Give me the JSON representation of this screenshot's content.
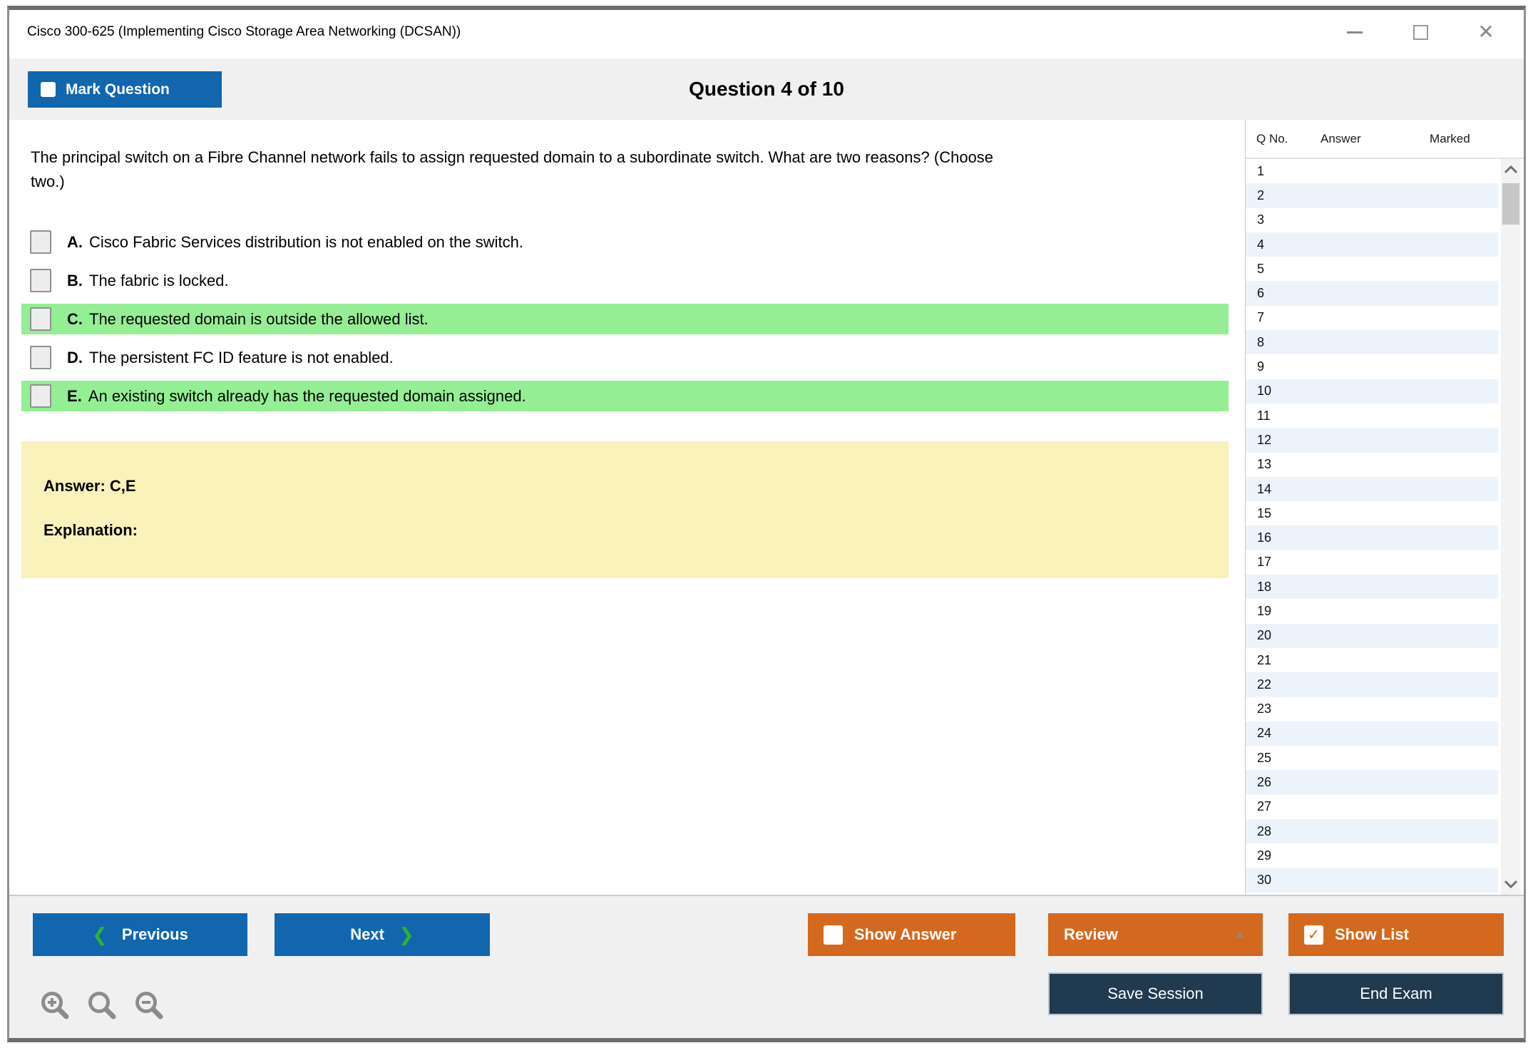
{
  "window": {
    "title": "Cisco 300-625 (Implementing Cisco Storage Area Networking (DCSAN))"
  },
  "header": {
    "mark_question_label": "Mark Question",
    "question_counter": "Question 4 of 10"
  },
  "question": {
    "text": "The principal switch on a Fibre Channel network fails to assign requested domain to a subordinate switch. What are two reasons? (Choose two.)",
    "options": [
      {
        "letter": "A.",
        "text": "Cisco Fabric Services distribution is not enabled on the switch.",
        "highlighted": false
      },
      {
        "letter": "B.",
        "text": "The fabric is locked.",
        "highlighted": false
      },
      {
        "letter": "C.",
        "text": "The requested domain is outside the allowed list.",
        "highlighted": true
      },
      {
        "letter": "D.",
        "text": "The persistent FC ID feature is not enabled.",
        "highlighted": false
      },
      {
        "letter": "E.",
        "text": "An existing switch already has the requested domain assigned.",
        "highlighted": true
      }
    ],
    "answer_label": "Answer: C,E",
    "explanation_label": "Explanation:"
  },
  "sidebar": {
    "columns": [
      "Q No.",
      "Answer",
      "Marked"
    ],
    "rows": [
      1,
      2,
      3,
      4,
      5,
      6,
      7,
      8,
      9,
      10,
      11,
      12,
      13,
      14,
      15,
      16,
      17,
      18,
      19,
      20,
      21,
      22,
      23,
      24,
      25,
      26,
      27,
      28,
      29,
      30
    ]
  },
  "footer": {
    "previous_label": "Previous",
    "next_label": "Next",
    "show_answer_label": "Show Answer",
    "review_label": "Review",
    "show_list_label": "Show List",
    "save_session_label": "Save Session",
    "end_exam_label": "End Exam"
  },
  "icons": {
    "close": "✕",
    "prev_chevron": "❮",
    "next_chevron": "❯",
    "review_caret": "▲",
    "checkmark": "✓"
  },
  "colors": {
    "accent_blue": "#1166ad",
    "accent_orange": "#d2691e",
    "accent_navy": "#203a50",
    "highlight_green": "#94ee94",
    "answer_yellow": "#faf2bb",
    "band_gray": "#f0f0f0",
    "alt_row_blue": "#ecf3fa"
  }
}
